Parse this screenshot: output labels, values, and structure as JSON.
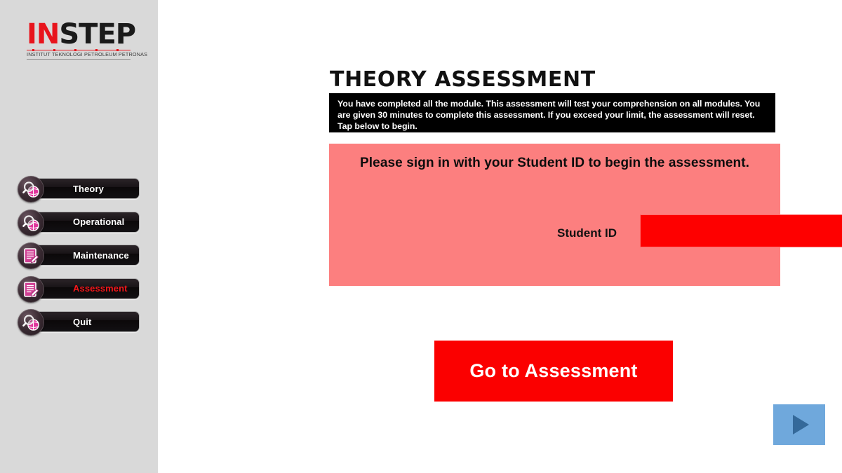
{
  "brand": {
    "logo_part1": "IN",
    "logo_part2": "STEP",
    "logo_subtitle": "INSTITUT TEKNOLOGI PETROLEUM PETRONAS"
  },
  "sidebar": {
    "items": [
      {
        "label": "Theory",
        "icon": "magnifier-globe-icon",
        "active": false
      },
      {
        "label": "Operational",
        "icon": "magnifier-globe-icon",
        "active": false
      },
      {
        "label": "Maintenance",
        "icon": "document-pencil-icon",
        "active": false
      },
      {
        "label": "Assessment",
        "icon": "document-pencil-icon",
        "active": true
      },
      {
        "label": "Quit",
        "icon": "magnifier-globe-icon",
        "active": false
      }
    ]
  },
  "main": {
    "title": "THEORY ASSESSMENT",
    "info_banner": "You have completed all the module. This assessment will test your comprehension on all modules. You are given 30 minutes to complete this assessment. If you exceed your limit, the assessment will reset. Tap below to begin.",
    "signin": {
      "heading": "Please sign in with your Student ID to begin the assessment.",
      "field_label": "Student ID",
      "field_value": "",
      "field_placeholder": ""
    },
    "go_button_label": "Go to Assessment",
    "next_button_icon": "play-triangle-icon"
  },
  "colors": {
    "sidebar_bg": "#d9d9d9",
    "page_bg": "#ffffff",
    "banner_bg": "#000000",
    "panel_pink": "#fc7f7f",
    "input_red": "#fe0000",
    "button_red": "#fb0000",
    "active_item_red": "#f5161a",
    "logo_red": "#e8141c",
    "next_button_blue": "#6fa8dc",
    "next_arrow_blue": "#34699a"
  }
}
